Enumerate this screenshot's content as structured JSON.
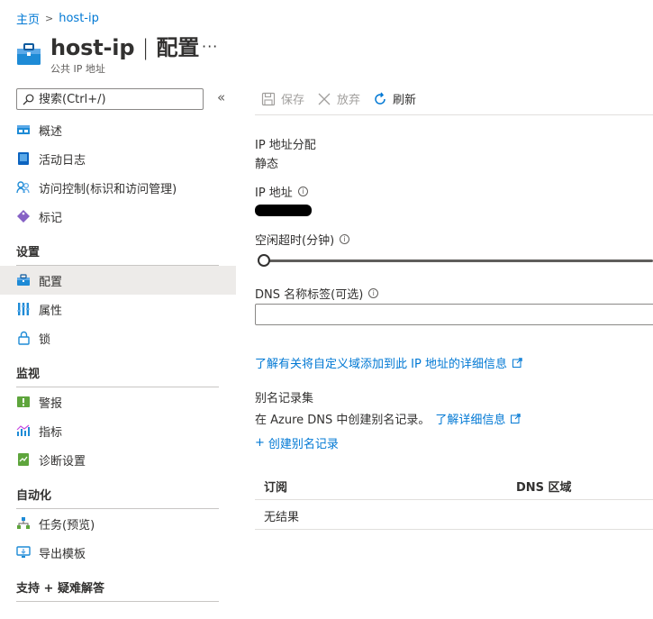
{
  "breadcrumb": {
    "home": "主页",
    "current": "host-ip"
  },
  "header": {
    "title_name": "host-ip",
    "title_sep": "|",
    "title_section": "配置",
    "subtitle": "公共 IP 地址",
    "more": "···"
  },
  "sidebar": {
    "search_placeholder": "搜索(Ctrl+/)",
    "collapse": "«",
    "items_top": [
      {
        "label": "概述",
        "icon": "overview-icon"
      },
      {
        "label": "活动日志",
        "icon": "activity-log-icon"
      },
      {
        "label": "访问控制(标识和访问管理)",
        "icon": "access-control-icon"
      },
      {
        "label": "标记",
        "icon": "tag-icon"
      }
    ],
    "sections": {
      "settings": "设置",
      "monitoring": "监视",
      "automation": "自动化",
      "support": "支持 + 疑难解答"
    },
    "settings_items": [
      {
        "label": "配置",
        "icon": "configuration-icon",
        "selected": true
      },
      {
        "label": "属性",
        "icon": "properties-icon"
      },
      {
        "label": "锁",
        "icon": "lock-icon"
      }
    ],
    "monitoring_items": [
      {
        "label": "警报",
        "icon": "alerts-icon"
      },
      {
        "label": "指标",
        "icon": "metrics-icon"
      },
      {
        "label": "诊断设置",
        "icon": "diagnostic-settings-icon"
      }
    ],
    "automation_items": [
      {
        "label": "任务(预览)",
        "icon": "tasks-icon"
      },
      {
        "label": "导出模板",
        "icon": "export-template-icon"
      }
    ]
  },
  "toolbar": {
    "save": "保存",
    "discard": "放弃",
    "refresh": "刷新"
  },
  "form": {
    "ip_assignment_label": "IP 地址分配",
    "ip_assignment_value": "静态",
    "ip_address_label": "IP 地址",
    "idle_timeout_label": "空闲超时(分钟)",
    "idle_timeout_level": 0,
    "dns_label_label": "DNS 名称标签(可选)",
    "dns_label_value": "",
    "custom_domain_link": "了解有关将自定义域添加到此 IP 地址的详细信息",
    "alias_title": "别名记录集",
    "alias_desc": "在 Azure DNS 中创建别名记录。",
    "learn_more": "了解详细信息",
    "create_alias": "创建别名记录",
    "create_alias_plus": "+"
  },
  "table": {
    "columns": [
      "订阅",
      "DNS 区域"
    ],
    "empty": "无结果"
  },
  "colors": {
    "accent": "#0078d4",
    "selected_bg": "#edebe9",
    "text": "#323130"
  }
}
